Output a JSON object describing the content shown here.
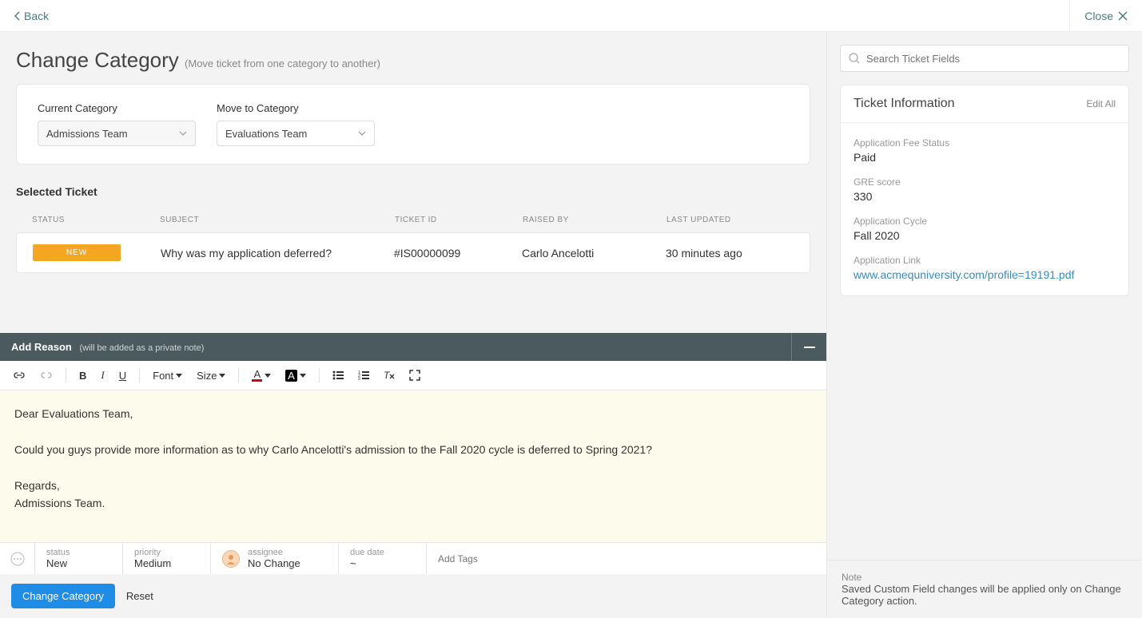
{
  "topbar": {
    "back": "Back",
    "close": "Close"
  },
  "page": {
    "title": "Change Category",
    "subtitle": "(Move ticket from one category to another)"
  },
  "categories": {
    "current_label": "Current Category",
    "current_value": "Admissions Team",
    "move_label": "Move to Category",
    "move_value": "Evaluations Team"
  },
  "selected": {
    "heading": "Selected Ticket",
    "cols": {
      "status": "STATUS",
      "subject": "SUBJECT",
      "ticket_id": "TICKET ID",
      "raised_by": "RAISED BY",
      "last_updated": "LAST UPDATED"
    },
    "row": {
      "status_badge": "NEW",
      "subject": "Why was my application deferred?",
      "ticket_id": "#IS00000099",
      "raised_by": "Carlo Ancelotti",
      "last_updated": "30 minutes ago"
    }
  },
  "editor": {
    "title": "Add Reason",
    "hint": "(will be added as a private note)",
    "toolbar": {
      "font": "Font",
      "size": "Size"
    },
    "body": "Dear Evaluations Team,\n\nCould you guys provide more information as to why Carlo Ancelotti's admission to the Fall 2020 cycle is deferred to Spring 2021?\n\nRegards,\nAdmissions Team."
  },
  "meta": {
    "status": {
      "k": "status",
      "v": "New"
    },
    "priority": {
      "k": "priority",
      "v": "Medium"
    },
    "assignee": {
      "k": "assignee",
      "v": "No Change"
    },
    "due": {
      "k": "due date",
      "v": "~"
    },
    "tags_placeholder": "Add Tags"
  },
  "actions": {
    "primary": "Change Category",
    "reset": "Reset"
  },
  "search": {
    "placeholder": "Search Ticket Fields"
  },
  "ticket_info": {
    "heading": "Ticket Information",
    "edit": "Edit All",
    "fields": [
      {
        "k": "Application Fee Status",
        "v": "Paid"
      },
      {
        "k": "GRE score",
        "v": "330"
      },
      {
        "k": "Application Cycle",
        "v": "Fall 2020"
      },
      {
        "k": "Application Link",
        "v": "www.acmequniversity.com/profile=19191.pdf",
        "link": true
      }
    ]
  },
  "note": {
    "label": "Note",
    "text": "Saved Custom Field changes will be applied only on Change Category action."
  }
}
